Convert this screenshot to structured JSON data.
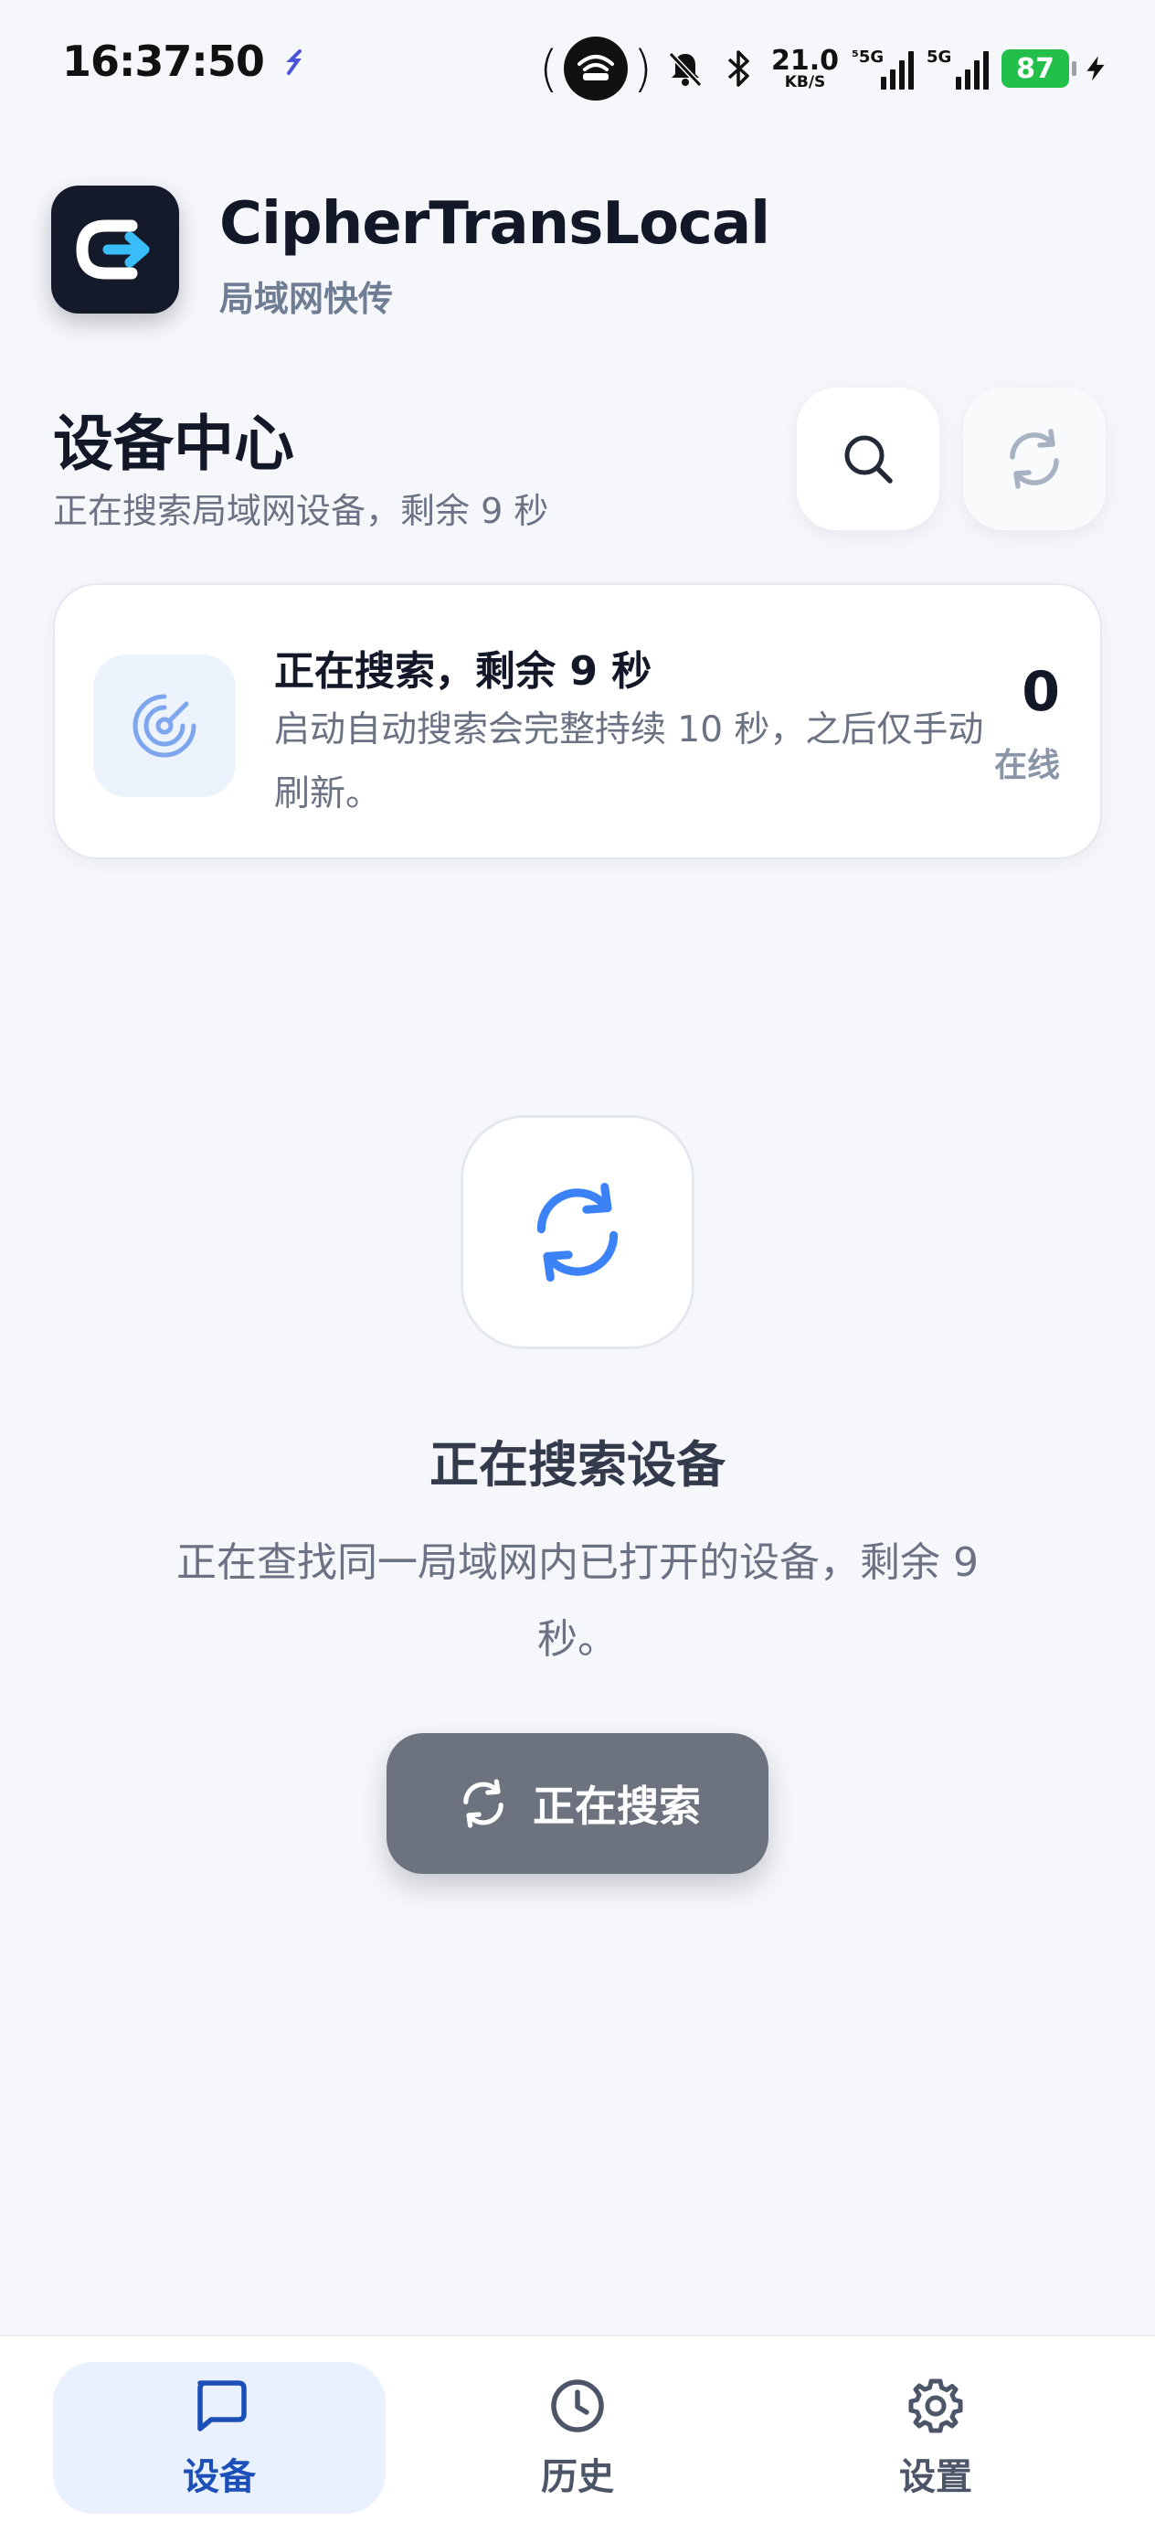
{
  "status_bar": {
    "time": "16:37:50",
    "net_speed_value": "21.0",
    "net_speed_unit": "KB/S",
    "sim1_label": "⁵5G",
    "sim2_label": "5G",
    "battery": "87",
    "icons": [
      "feather-icon",
      "hotspot-icon",
      "mute-icon",
      "bluetooth-icon",
      "signal-icon",
      "charging-icon"
    ]
  },
  "app": {
    "name": "CipherTransLocal",
    "subtitle": "局域网快传"
  },
  "page": {
    "title": "设备中心",
    "subtitle": "正在搜索局域网设备，剩余 9 秒"
  },
  "status_card": {
    "title": "正在搜索，剩余 9 秒",
    "description": "启动自动搜索会完整持续 10 秒，之后仅手动刷新。",
    "count": "0",
    "count_label": "在线",
    "icon": "radar-icon"
  },
  "empty_state": {
    "title": "正在搜索设备",
    "description": "正在查找同一局域网内已打开的设备，剩余 9 秒。",
    "button_label": "正在搜索",
    "icon": "refresh-icon"
  },
  "bottom_nav": {
    "items": [
      {
        "label": "设备",
        "icon": "chat-icon",
        "active": true
      },
      {
        "label": "历史",
        "icon": "clock-icon",
        "active": false
      },
      {
        "label": "设置",
        "icon": "gear-icon",
        "active": false
      }
    ]
  },
  "colors": {
    "accent": "#3b82f6",
    "active_nav": "#1c4fb8",
    "background": "#f6f7fb",
    "logo_bg": "#151a2a",
    "battery": "#22c04a"
  }
}
